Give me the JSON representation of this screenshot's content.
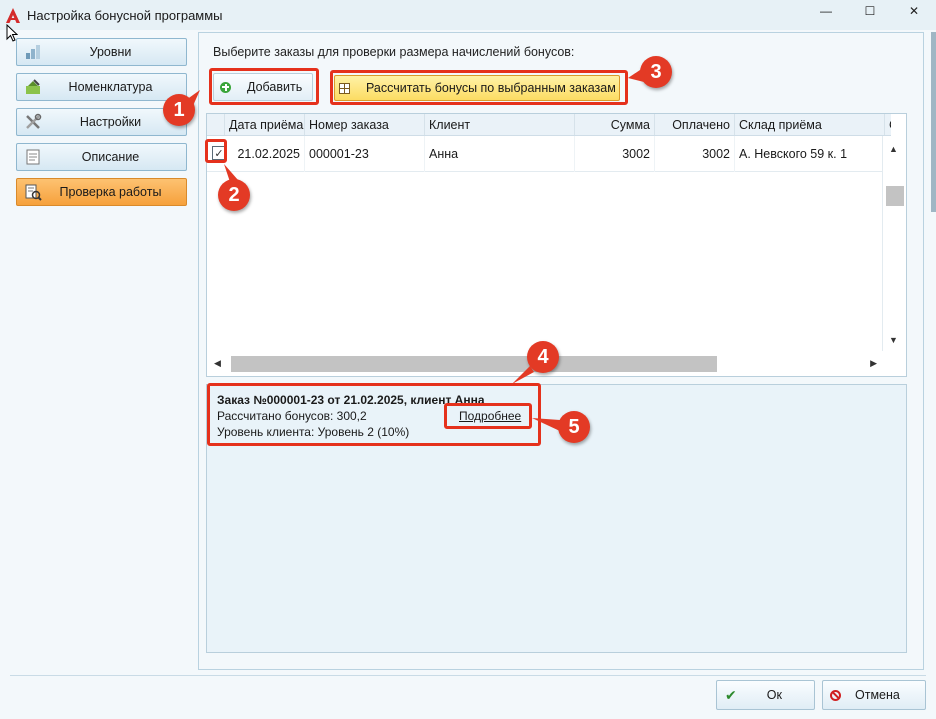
{
  "window": {
    "title": "Настройка бонусной программы",
    "controls": {
      "minimize": "—",
      "maximize": "☐",
      "close": "✕"
    }
  },
  "nav": {
    "items": [
      {
        "label": "Уровни",
        "icon": "levels-icon",
        "active": false
      },
      {
        "label": "Номенклатура",
        "icon": "nomenclature-icon",
        "active": false
      },
      {
        "label": "Настройки",
        "icon": "settings-tools-icon",
        "active": false
      },
      {
        "label": "Описание",
        "icon": "document-icon",
        "active": false
      },
      {
        "label": "Проверка работы",
        "icon": "check-work-icon",
        "active": true
      }
    ]
  },
  "main": {
    "instruction": "Выберите заказы для проверки размера начислений бонусов:",
    "add_button": "Добавить",
    "calc_button": "Рассчитать бонусы по выбранным заказам"
  },
  "grid": {
    "columns": [
      "Дата приёма",
      "Номер заказа",
      "Клиент",
      "Сумма",
      "Оплачено",
      "Склад приёма",
      "Ск"
    ],
    "rows": [
      {
        "checked": true,
        "date": "21.02.2025",
        "order": "000001-23",
        "client": "Анна",
        "sum": "3002",
        "paid": "3002",
        "warehouse": "А. Невского 59 к. 1"
      }
    ]
  },
  "detail": {
    "title": "Заказ №000001-23 от 21.02.2025, клиент Анна",
    "bonus_line": "Рассчитано бонусов: 300,2",
    "level_line": "Уровень клиента: Уровень 2 (10%)",
    "more_link": "Подробнее"
  },
  "annotations": [
    "1",
    "2",
    "3",
    "4",
    "5"
  ],
  "footer": {
    "ok": "Ок",
    "cancel": "Отмена"
  },
  "colors": {
    "annotation": "#e5311c",
    "active_nav": "#f6a13c",
    "calc_button": "#fcdc63"
  }
}
